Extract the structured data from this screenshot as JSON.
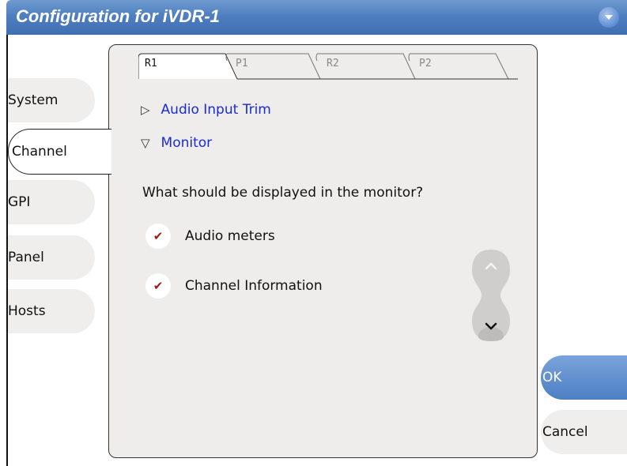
{
  "window": {
    "title": "Configuration for iVDR-1",
    "menu_icon": "chevron-down-icon"
  },
  "sidebar": {
    "items": [
      {
        "label": "System"
      },
      {
        "label": "Channel",
        "active": true
      },
      {
        "label": "GPI"
      },
      {
        "label": "Panel"
      },
      {
        "label": "Hosts"
      }
    ]
  },
  "tabs": [
    {
      "label": "R1",
      "active": true
    },
    {
      "label": "P1"
    },
    {
      "label": "R2"
    },
    {
      "label": "P2"
    }
  ],
  "sections": {
    "audio_input_trim": {
      "label": "Audio Input Trim",
      "expanded": false
    },
    "monitor": {
      "label": "Monitor",
      "expanded": true
    }
  },
  "question": "What should be displayed in the monitor?",
  "options": [
    {
      "label": "Audio meters",
      "checked": true
    },
    {
      "label": "Channel Information",
      "checked": true
    }
  ],
  "buttons": {
    "ok": "OK",
    "cancel": "Cancel"
  },
  "colors": {
    "title_bar": "#4f7fbf",
    "link_blue": "#1a2ad8",
    "check_red": "#a01818",
    "panel_bg": "#eeedeb"
  }
}
